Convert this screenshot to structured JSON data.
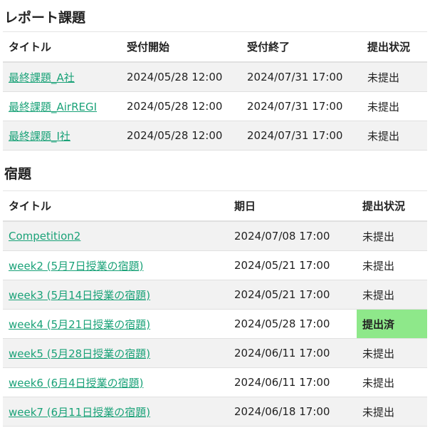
{
  "reports": {
    "title": "レポート課題",
    "headers": [
      "タイトル",
      "受付開始",
      "受付終了",
      "提出状況"
    ],
    "rows": [
      {
        "title": "最終課題_A社",
        "start": "2024/05/28 12:00",
        "end": "2024/07/31 17:00",
        "status": "未提出"
      },
      {
        "title": "最終課題_AirREGI",
        "start": "2024/05/28 12:00",
        "end": "2024/07/31 17:00",
        "status": "未提出"
      },
      {
        "title": "最終課題_I社",
        "start": "2024/05/28 12:00",
        "end": "2024/07/31 17:00",
        "status": "未提出"
      }
    ]
  },
  "homework": {
    "title": "宿題",
    "headers": [
      "タイトル",
      "期日",
      "提出状況"
    ],
    "rows": [
      {
        "title": "Competition2",
        "due": "2024/07/08 17:00",
        "status": "未提出",
        "submitted": false
      },
      {
        "title": "week2 (5月7日授業の宿題)",
        "due": "2024/05/21 17:00",
        "status": "未提出",
        "submitted": false
      },
      {
        "title": "week3 (5月14日授業の宿題)",
        "due": "2024/05/21 17:00",
        "status": "未提出",
        "submitted": false
      },
      {
        "title": "week4 (5月21日授業の宿題)",
        "due": "2024/05/28 17:00",
        "status": "提出済",
        "submitted": true
      },
      {
        "title": "week5 (5月28日授業の宿題)",
        "due": "2024/06/11 17:00",
        "status": "未提出",
        "submitted": false
      },
      {
        "title": "week6 (6月4日授業の宿題)",
        "due": "2024/06/11 17:00",
        "status": "未提出",
        "submitted": false
      },
      {
        "title": "week7 (6月11日授業の宿題)",
        "due": "2024/06/18 17:00",
        "status": "未提出",
        "submitted": false
      }
    ]
  },
  "colors": {
    "link": "#1aa278",
    "submitted_bg": "#8ee88a",
    "stripe_bg": "#f2f2f2"
  }
}
